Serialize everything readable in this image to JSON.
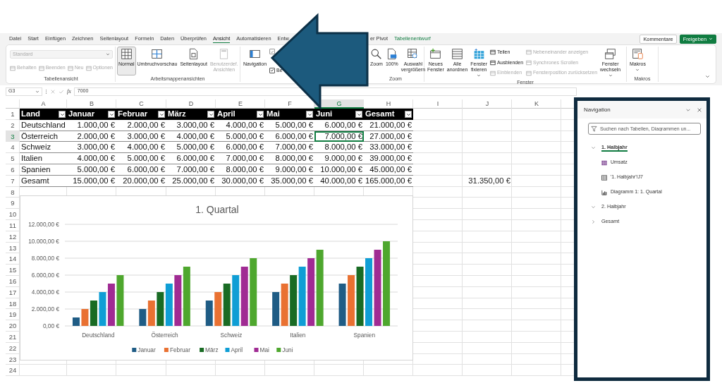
{
  "ribbon_tabs": [
    {
      "label": "Datei",
      "selected": false
    },
    {
      "label": "Start",
      "selected": false
    },
    {
      "label": "Einfügen",
      "selected": false
    },
    {
      "label": "Zeichnen",
      "selected": false
    },
    {
      "label": "Seitenlayout",
      "selected": false
    },
    {
      "label": "Formeln",
      "selected": false
    },
    {
      "label": "Daten",
      "selected": false
    },
    {
      "label": "Überprüfen",
      "selected": false
    },
    {
      "label": "Ansicht",
      "selected": true
    },
    {
      "label": "Automatisieren",
      "selected": false
    },
    {
      "label": "Entw",
      "selected": false
    },
    {
      "label": "er Pivot",
      "selected": false
    },
    {
      "label": "Tabellenentwurf",
      "selected": false,
      "kind": "contextual"
    }
  ],
  "header_buttons": [
    {
      "label": "Kommentare",
      "kind": "outline"
    },
    {
      "label": "Freigeben",
      "kind": "primary",
      "menu": true
    }
  ],
  "ribbon": {
    "groups": [
      {
        "label": "Tabellenansicht",
        "items": [
          {
            "kind": "stack",
            "items": [
              {
                "kind": "dropdown",
                "value": "Standard",
                "disabled": true
              },
              {
                "kind": "row",
                "items": [
                  {
                    "kind": "small",
                    "label": "Behalten",
                    "disabled": true
                  },
                  {
                    "kind": "small",
                    "label": "Beenden",
                    "disabled": true
                  },
                  {
                    "kind": "small",
                    "label": "Neu",
                    "disabled": true
                  },
                  {
                    "kind": "small",
                    "label": "Optionen",
                    "disabled": true
                  }
                ]
              }
            ]
          }
        ]
      },
      {
        "label": "Arbeitsmappenansichten",
        "items": [
          {
            "kind": "large",
            "label": "Normal",
            "selected": true,
            "disabled": false
          },
          {
            "kind": "large",
            "label": "Umbruchvorschau",
            "selected": false,
            "disabled": false
          },
          {
            "kind": "large",
            "label": "Seitenlayout",
            "selected": false,
            "disabled": false
          },
          {
            "kind": "large",
            "label": "Benutzerdef. Ansichten",
            "selected": false,
            "disabled": true
          }
        ]
      },
      {
        "items": [
          {
            "kind": "large",
            "label": "Navigation",
            "disabled": false
          },
          {
            "kind": "stack",
            "items": [
              {
                "kind": "check",
                "checked": true,
                "disabled": true
              },
              {
                "kind": "check",
                "label": "Be",
                "checked": true,
                "disabled": false
              }
            ]
          }
        ]
      },
      {
        "label": "Zoom",
        "items": [
          {
            "kind": "large",
            "label": "Zoom",
            "disabled": false
          },
          {
            "kind": "large",
            "label": "100%",
            "disabled": false
          },
          {
            "kind": "large",
            "label": "Auswahl vergrößern",
            "disabled": false
          }
        ]
      },
      {
        "label": "Fenster",
        "items": [
          {
            "kind": "large",
            "label": "Neues Fenster",
            "disabled": false
          },
          {
            "kind": "large",
            "label": "Alle anordnen",
            "disabled": false
          },
          {
            "kind": "large",
            "label": "Fenster fixieren",
            "disabled": false,
            "menu": true
          },
          {
            "kind": "stack",
            "items": [
              {
                "kind": "small",
                "label": "Teilen",
                "disabled": false
              },
              {
                "kind": "small",
                "label": "Ausblenden",
                "disabled": false
              },
              {
                "kind": "small",
                "label": "Einblenden",
                "disabled": true
              }
            ]
          },
          {
            "kind": "stack",
            "items": [
              {
                "kind": "small",
                "label": "Nebeneinander anzeigen",
                "disabled": true
              },
              {
                "kind": "small",
                "label": "Synchrones Scrollen",
                "disabled": true
              },
              {
                "kind": "small",
                "label": "Fensterposition zurücksetzen",
                "disabled": true
              }
            ]
          },
          {
            "kind": "large",
            "label": "Fenster wechseln",
            "disabled": false,
            "menu": true
          }
        ]
      },
      {
        "label": "Makros",
        "items": [
          {
            "kind": "large",
            "label": "Makros",
            "disabled": false,
            "menu": true
          }
        ]
      }
    ]
  },
  "formula_bar": {
    "name_box": "G3",
    "function_label": "fx",
    "value": "7000"
  },
  "sheet": {
    "columns": [
      {
        "label": "A",
        "selected": false
      },
      {
        "label": "B",
        "selected": false
      },
      {
        "label": "C",
        "selected": false
      },
      {
        "label": "D",
        "selected": false
      },
      {
        "label": "E",
        "selected": false
      },
      {
        "label": "F",
        "selected": false
      },
      {
        "label": "G",
        "selected": true
      },
      {
        "label": "H",
        "selected": false
      },
      {
        "label": "I",
        "selected": false
      },
      {
        "label": "J",
        "selected": false
      },
      {
        "label": "K",
        "selected": false
      }
    ],
    "rows": [
      {
        "number": "1",
        "selected": false
      },
      {
        "number": "2",
        "selected": false
      },
      {
        "number": "3",
        "selected": true
      },
      {
        "number": "4",
        "selected": false
      },
      {
        "number": "5",
        "selected": false
      },
      {
        "number": "6",
        "selected": false
      },
      {
        "number": "7",
        "selected": false
      },
      {
        "number": "8",
        "selected": false
      },
      {
        "number": "9",
        "selected": false
      },
      {
        "number": "10",
        "selected": false
      },
      {
        "number": "11",
        "selected": false
      },
      {
        "number": "12",
        "selected": false
      },
      {
        "number": "13",
        "selected": false
      },
      {
        "number": "14",
        "selected": false
      },
      {
        "number": "15",
        "selected": false
      },
      {
        "number": "16",
        "selected": false
      },
      {
        "number": "17",
        "selected": false
      },
      {
        "number": "18",
        "selected": false
      },
      {
        "number": "19",
        "selected": false
      },
      {
        "number": "20",
        "selected": false
      },
      {
        "number": "21",
        "selected": false
      },
      {
        "number": "22",
        "selected": false
      },
      {
        "number": "23",
        "selected": false
      },
      {
        "number": "24",
        "selected": false
      }
    ]
  },
  "table": {
    "header": [
      "Land",
      "Januar",
      "Februar",
      "März",
      "April",
      "Mai",
      "Juni",
      "Gesamt"
    ],
    "rows": [
      {
        "cells": [
          "Deutschland",
          "1.000,00 €",
          "2.000,00 €",
          "3.000,00 €",
          "4.000,00 €",
          "5.000,00 €",
          "6.000,00 €",
          "21.000,00 €"
        ]
      },
      {
        "cells": [
          "Österreich",
          "2.000,00 €",
          "3.000,00 €",
          "4.000,00 €",
          "5.000,00 €",
          "6.000,00 €",
          "7.000,00 €",
          "27.000,00 €"
        ]
      },
      {
        "cells": [
          "Schweiz",
          "3.000,00 €",
          "4.000,00 €",
          "5.000,00 €",
          "6.000,00 €",
          "7.000,00 €",
          "8.000,00 €",
          "33.000,00 €"
        ]
      },
      {
        "cells": [
          "Italien",
          "4.000,00 €",
          "5.000,00 €",
          "6.000,00 €",
          "7.000,00 €",
          "8.000,00 €",
          "9.000,00 €",
          "39.000,00 €"
        ]
      },
      {
        "cells": [
          "Spanien",
          "5.000,00 €",
          "6.000,00 €",
          "7.000,00 €",
          "8.000,00 €",
          "9.000,00 €",
          "10.000,00 €",
          "45.000,00 €"
        ]
      },
      {
        "cells": [
          "Gesamt",
          "15.000,00 €",
          "20.000,00 €",
          "25.000,00 €",
          "30.000,00 €",
          "35.000,00 €",
          "40.000,00 €",
          "165.000,00 €"
        ],
        "column_j": "31.350,00 €"
      }
    ]
  },
  "chart": {
    "chart_data": {
      "type": "bar",
      "title": "1. Quartal",
      "categories": [
        "Deutschland",
        "Österreich",
        "Schweiz",
        "Italien",
        "Spanien"
      ],
      "series": [
        {
          "name": "Januar",
          "color": "#1f5c85",
          "values": [
            1000,
            2000,
            3000,
            4000,
            5000
          ]
        },
        {
          "name": "Februar",
          "color": "#e97132",
          "values": [
            2000,
            3000,
            4000,
            5000,
            6000
          ]
        },
        {
          "name": "März",
          "color": "#196b24",
          "values": [
            3000,
            4000,
            5000,
            6000,
            7000
          ]
        },
        {
          "name": "April",
          "color": "#0f9ed5",
          "values": [
            4000,
            5000,
            6000,
            7000,
            8000
          ]
        },
        {
          "name": "Mai",
          "color": "#a02b93",
          "values": [
            5000,
            6000,
            7000,
            8000,
            9000
          ]
        },
        {
          "name": "Juni",
          "color": "#4ea72e",
          "values": [
            6000,
            7000,
            8000,
            9000,
            10000
          ]
        }
      ],
      "ylim": [
        0,
        12000
      ],
      "grid": true,
      "legend": "bottom",
      "yticks": [
        {
          "value": 0,
          "label": "0,00 €"
        },
        {
          "value": 2000,
          "label": "2.000,00 €"
        },
        {
          "value": 4000,
          "label": "4.000,00 €"
        },
        {
          "value": 6000,
          "label": "6.000,00 €"
        },
        {
          "value": 8000,
          "label": "8.000,00 €"
        },
        {
          "value": 10000,
          "label": "10.000,00 €"
        },
        {
          "value": 12000,
          "label": "12.000,00 €"
        }
      ]
    }
  },
  "navigation_pane": {
    "title": "Navigation",
    "search": {
      "placeholder": "Suchen nach Tabellen, Diagrammen un..."
    },
    "tree": [
      {
        "label": "1. Halbjahr",
        "expanded": true,
        "selected": true,
        "children": [
          {
            "kind": "table",
            "label": "Umsatz",
            "selected": false
          },
          {
            "kind": "range",
            "label": "'1. Halbjahr'!J7",
            "selected": false
          },
          {
            "kind": "chart",
            "label": "Diagramm 1: 1. Quartal",
            "selected": false
          }
        ]
      },
      {
        "label": "2. Halbjahr",
        "expanded": true,
        "selected": false
      },
      {
        "label": "Gesamt",
        "expanded": false,
        "selected": false
      }
    ]
  }
}
